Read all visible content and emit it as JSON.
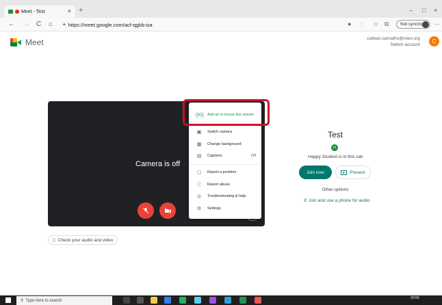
{
  "browser": {
    "tab_title": "Meet - Test",
    "tab_close": "×",
    "new_tab": "+",
    "url": "https://meet.google.com/acf-qgkb-iza",
    "sync_label": "Not syncing",
    "nav": {
      "back": "←",
      "forward": "→",
      "reload": "C",
      "home": "⌂"
    },
    "window": {
      "minimize": "–",
      "maximize": "□",
      "close": "×"
    },
    "toolbar_more": "···"
  },
  "meet": {
    "app_name": "Meet",
    "account_email": "cailean.carvalho@viiex.org",
    "switch_account": "Switch account",
    "avatar_initial": "C",
    "camera_off": "Camera is off",
    "check_audio_video": "Check your audio and video",
    "meeting_title": "Test",
    "participant_initial": "H",
    "in_call_text": "Happy Student is in this call",
    "join_now": "Join now",
    "present": "Present",
    "other_options": "Other options",
    "join_by_phone": "Join and use a phone for audio"
  },
  "menu": {
    "items": [
      {
        "label": "Add an in-house live stream",
        "icon": "((•))"
      },
      {
        "label": "Switch camera",
        "icon": "▣"
      },
      {
        "label": "Change background",
        "icon": "▦"
      },
      {
        "label": "Captions",
        "icon": "▤",
        "value": "Off"
      },
      {
        "label": "Report a problem",
        "icon": "▢"
      },
      {
        "label": "Report abuse",
        "icon": "ⓘ"
      },
      {
        "label": "Troubleshooting & help",
        "icon": "◎"
      },
      {
        "label": "Settings",
        "icon": "⚙"
      }
    ]
  },
  "taskbar": {
    "search_placeholder": "Type here to search",
    "clock": "20:59"
  },
  "colors": {
    "accent_teal": "#00796b",
    "danger_red": "#ea4335",
    "highlight_red": "#c8102e",
    "preview_bg": "#202124",
    "live_stream_green": "#1e8e3e"
  }
}
